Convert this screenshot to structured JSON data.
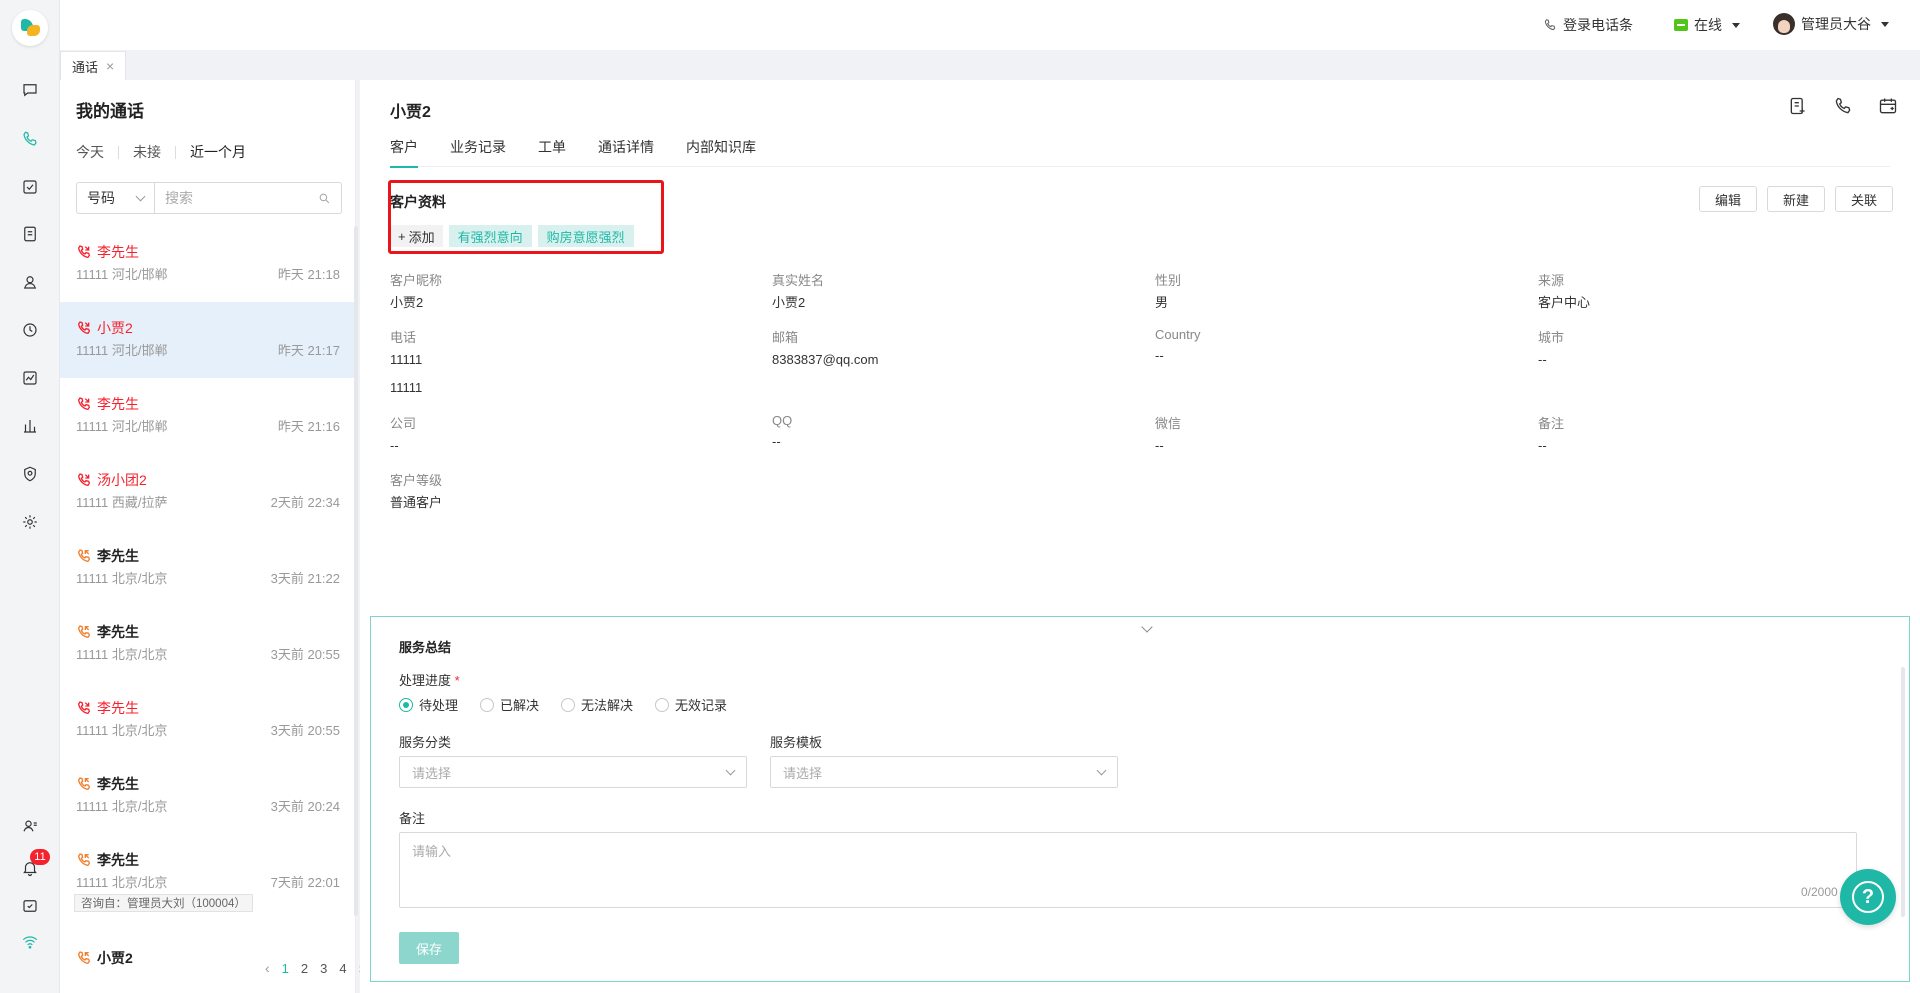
{
  "header": {
    "phone_bar_label": "登录电话条",
    "status_label": "在线",
    "user_name": "管理员大谷"
  },
  "tabs": [
    {
      "label": "通话",
      "close": "×"
    }
  ],
  "calls_panel": {
    "title": "我的通话",
    "period_tabs": [
      "今天",
      "未接",
      "近一个月"
    ],
    "active_period": "近一个月",
    "search_type": "号码",
    "search_placeholder": "搜索",
    "items": [
      {
        "name": "李先生",
        "info": "11111 河北/邯郸",
        "time": "昨天 21:18",
        "status": "missed"
      },
      {
        "name": "小贾2",
        "info": "11111 河北/邯郸",
        "time": "昨天 21:17",
        "status": "missed",
        "selected": true
      },
      {
        "name": "李先生",
        "info": "11111 河北/邯郸",
        "time": "昨天 21:16",
        "status": "missed"
      },
      {
        "name": "汤小团2",
        "info": "11111 西藏/拉萨",
        "time": "2天前 22:34",
        "status": "missed"
      },
      {
        "name": "李先生",
        "info": "11111 北京/北京",
        "time": "3天前 21:22",
        "status": "answered"
      },
      {
        "name": "李先生",
        "info": "11111 北京/北京",
        "time": "3天前 20:55",
        "status": "answered"
      },
      {
        "name": "李先生",
        "info": "11111 北京/北京",
        "time": "3天前 20:55",
        "status": "missed"
      },
      {
        "name": "李先生",
        "info": "11111 北京/北京",
        "time": "3天前 20:24",
        "status": "answered"
      },
      {
        "name": "李先生",
        "info": "11111 北京/北京",
        "time": "7天前 22:01",
        "status": "answered",
        "note": "咨询自：管理员大刘（100004）"
      },
      {
        "name": "小贾2",
        "info": "",
        "time": "",
        "status": "answered"
      }
    ],
    "pagination": {
      "pages": [
        "1",
        "2",
        "3",
        "4"
      ],
      "current": "1",
      "prev": "‹",
      "next": "›"
    }
  },
  "notifications_count": "11",
  "detail": {
    "title": "小贾2",
    "tabs": [
      "客户",
      "业务记录",
      "工单",
      "通话详情",
      "内部知识库"
    ],
    "active_tab": "客户",
    "section_title": "客户资料",
    "add_tag_label": "添加",
    "tags": [
      "有强烈意向",
      "购房意愿强烈"
    ],
    "actions": [
      "编辑",
      "新建",
      "关联"
    ],
    "fields": [
      {
        "label": "客户昵称",
        "value": "小贾2"
      },
      {
        "label": "真实姓名",
        "value": "小贾2"
      },
      {
        "label": "性别",
        "value": "男"
      },
      {
        "label": "来源",
        "value": "客户中心"
      },
      {
        "label": "电话",
        "value": "11111",
        "value2": "11111"
      },
      {
        "label": "邮箱",
        "value": "8383837@qq.com"
      },
      {
        "label": "Country",
        "value": "--"
      },
      {
        "label": "城市",
        "value": "--"
      },
      {
        "label": "公司",
        "value": "--"
      },
      {
        "label": "QQ",
        "value": "--"
      },
      {
        "label": "微信",
        "value": "--"
      },
      {
        "label": "备注",
        "value": "--"
      },
      {
        "label": "客户等级",
        "value": "普通客户"
      }
    ]
  },
  "summary": {
    "title": "服务总结",
    "progress_label": "处理进度",
    "required_mark": "*",
    "progress_options": [
      "待处理",
      "已解决",
      "无法解决",
      "无效记录"
    ],
    "progress_selected": "待处理",
    "category_label": "服务分类",
    "category_placeholder": "请选择",
    "template_label": "服务模板",
    "template_placeholder": "请选择",
    "remark_label": "备注",
    "remark_placeholder": "请输入",
    "remark_counter": "0/2000",
    "save_label": "保存"
  },
  "help_label": "?",
  "colors": {
    "accent": "#1fb8a6",
    "missed": "#f5222d",
    "answered": "#f07f2d",
    "highlight": "#e8151b"
  }
}
